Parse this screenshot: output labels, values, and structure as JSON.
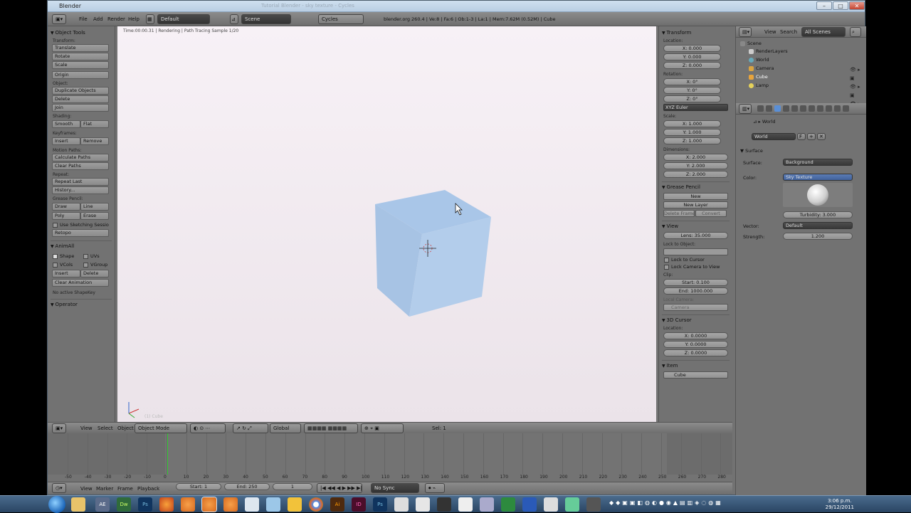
{
  "titlebar": {
    "title": "Blender",
    "faint": "Tutorial Blender - sky texture - Cycles"
  },
  "topbar": {
    "menus": [
      "File",
      "Add",
      "Render",
      "Help"
    ],
    "layout": "Default",
    "scene": "Scene",
    "engine": "Cycles",
    "stats": "blender.org 260.4 | Ve:8 | Fa:6 | Ob:1-3 | La:1 | Mem:7.62M (0.52M) | Cube"
  },
  "tools": {
    "title": "Object Tools",
    "transform_label": "Transform:",
    "translate": "Translate",
    "rotate": "Rotate",
    "scale": "Scale",
    "origin": "Origin",
    "object_label": "Object:",
    "duplicate": "Duplicate Objects",
    "delete": "Delete",
    "join": "Join",
    "shading_label": "Shading:",
    "smooth": "Smooth",
    "flat": "Flat",
    "keyframes_label": "Keyframes:",
    "insert": "Insert",
    "remove": "Remove",
    "motion_label": "Motion Paths:",
    "calc_paths": "Calculate Paths",
    "clear_paths": "Clear Paths",
    "repeat_label": "Repeat:",
    "repeat_last": "Repeat Last",
    "history": "History...",
    "grease_label": "Grease Pencil:",
    "draw": "Draw",
    "line": "Line",
    "poly": "Poly",
    "erase": "Erase",
    "sketching": "Use Sketching Sessio",
    "retopo": "Retopo",
    "animall_title": "AnimAll",
    "shape": "Shape",
    "uvs": "UVs",
    "vcols": "VCols",
    "vgroup": "VGroup",
    "aa_insert": "Insert",
    "aa_delete": "Delete",
    "clear_anim": "Clear Animation",
    "no_shapekey": "No active ShapeKey",
    "operator_title": "Operator"
  },
  "viewport": {
    "info": "Time:00:00.31 | Rendering | Path Tracing Sample 1/20",
    "object": "(1) Cube"
  },
  "npanel": {
    "transform_title": "Transform",
    "location_label": "Location:",
    "loc": [
      "X: 0.000",
      "Y: 0.000",
      "Z: 0.000"
    ],
    "rotation_label": "Rotation:",
    "rot": [
      "X: 0°",
      "Y: 0°",
      "Z: 0°"
    ],
    "rot_mode": "XYZ Euler",
    "scale_label": "Scale:",
    "scale": [
      "X: 1.000",
      "Y: 1.000",
      "Z: 1.000"
    ],
    "dimensions_label": "Dimensions:",
    "dim": [
      "X: 2.000",
      "Y: 2.000",
      "Z: 2.000"
    ],
    "grease_title": "Grease Pencil",
    "gp_new": "New",
    "gp_new_layer": "New Layer",
    "gp_delete_frame": "Delete Frame",
    "gp_convert": "Convert",
    "view_title": "View",
    "lens": "Lens: 35.000",
    "lock_obj_label": "Lock to Object:",
    "lock_cursor": "Lock to Cursor",
    "lock_camera": "Lock Camera to View",
    "clip_label": "Clip:",
    "clip_start": "Start: 0.100",
    "clip_end": "End: 1000.000",
    "local_camera_label": "Local Camera:",
    "camera": "Camera",
    "cursor_title": "3D Cursor",
    "cursor_loc_label": "Location:",
    "cursor": [
      "X: 0.0000",
      "Y: 0.0000",
      "Z: 0.0000"
    ],
    "item_title": "Item",
    "item_name": "Cube"
  },
  "outliner": {
    "view": "View",
    "search": "Search",
    "scenes": "All Scenes",
    "items": [
      "Scene",
      "RenderLayers",
      "World",
      "Camera",
      "Cube",
      "Lamp"
    ]
  },
  "props": {
    "breadcrumb": "World",
    "world_name": "World",
    "f": "F",
    "surface_title": "Surface",
    "surface_label": "Surface:",
    "surface_value": "Background",
    "color_label": "Color:",
    "color_value": "Sky Texture",
    "turbidity": "Turbidity: 3.000",
    "vector_label": "Vector:",
    "vector_value": "Default",
    "strength_label": "Strength:",
    "strength_value": "1.200"
  },
  "vphdr": {
    "view": "View",
    "select": "Select",
    "object": "Object",
    "mode": "Object Mode",
    "orientation": "Global",
    "sel_count": "Sel: 1"
  },
  "timeline": {
    "ticks": [
      "-50",
      "-40",
      "-30",
      "-20",
      "-10",
      "0",
      "10",
      "20",
      "30",
      "40",
      "50",
      "60",
      "70",
      "80",
      "90",
      "100",
      "110",
      "120",
      "130",
      "140",
      "150",
      "160",
      "170",
      "180",
      "190",
      "200",
      "210",
      "220",
      "230",
      "240",
      "250",
      "260",
      "270",
      "280"
    ],
    "view": "View",
    "marker": "Marker",
    "frame": "Frame",
    "playback": "Playback",
    "start": "Start: 1",
    "end": "End: 250",
    "current": "1",
    "sync": "No Sync"
  },
  "taskbar": {
    "time": "3:06 p.m.",
    "date": "29/12/2011",
    "apps": [
      "Dw",
      "Ps",
      "Ai",
      "ID",
      "Ps"
    ]
  }
}
